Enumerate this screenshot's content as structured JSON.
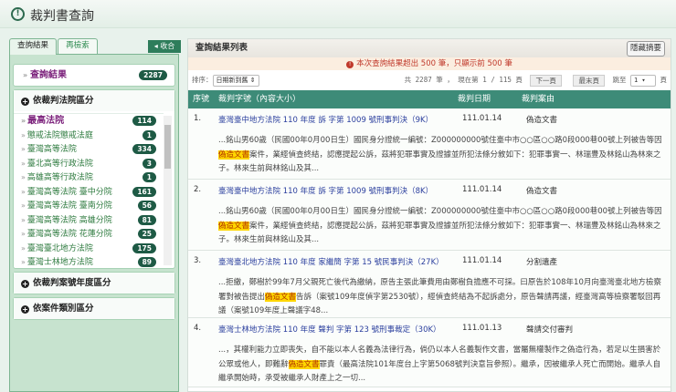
{
  "header": {
    "title": "裁判書查詢"
  },
  "sidebar": {
    "tabs": [
      "查詢結果",
      "再檢索"
    ],
    "collapse_label": "收合",
    "results": {
      "label": "查詢結果",
      "count": "2287"
    },
    "court_section": {
      "title": "依裁判法院區分",
      "items": [
        {
          "label": "最高法院",
          "count": "114"
        },
        {
          "label": "懲戒法院懲戒法庭",
          "count": "1"
        },
        {
          "label": "臺灣高等法院",
          "count": "334"
        },
        {
          "label": "臺北高等行政法院",
          "count": "3"
        },
        {
          "label": "高雄高等行政法院",
          "count": "1"
        },
        {
          "label": "臺灣高等法院 臺中分院",
          "count": "161"
        },
        {
          "label": "臺灣高等法院 臺南分院",
          "count": "56"
        },
        {
          "label": "臺灣高等法院 高雄分院",
          "count": "81"
        },
        {
          "label": "臺灣高等法院 花蓮分院",
          "count": "25"
        },
        {
          "label": "臺灣臺北地方法院",
          "count": "175"
        },
        {
          "label": "臺灣士林地方法院",
          "count": "89"
        }
      ]
    },
    "year_section": {
      "title": "依裁判案號年度區分"
    },
    "type_section": {
      "title": "依案件類別區分"
    }
  },
  "main": {
    "title": "查詢結果列表",
    "hide_summary": "隱藏摘要",
    "warning": "本次查詢結果超出 500 筆，只顯示前 500 筆",
    "sort_label": "排序：",
    "sort_value": "日期新到舊 ⇕",
    "paging": "共 2287 筆 ， 現在第 1 / 115 頁",
    "next": "下一頁",
    "last": "最末頁",
    "jump_label": "跳至",
    "jump_value": "1 ▾",
    "page_unit": "頁",
    "columns": [
      "序號",
      "裁判字號（內容大小）",
      "裁判日期",
      "裁判案由"
    ],
    "rows": [
      {
        "num": "1.",
        "title": "臺灣臺中地方法院 110 年度 訴 字第 1009 號刑事判決（9K）",
        "date": "111.01.14",
        "reason": "偽造文書",
        "pre": "...銘山男60歲（民國00年0月00日生）國民身分證統一編號：Z000000000號住臺中市○○區○○路0段000巷00號上列被告等因",
        "hl": "偽造文書",
        "post": "案件，業經偵查終結，認應提起公訴，茲將犯罪事實及證據並所犯法條分敘如下：犯罪事實一、林瑞豊及林銘山為林來之子。林來生前與林銘山及其..."
      },
      {
        "num": "2.",
        "title": "臺灣臺中地方法院 110 年度 訴 字第 1009 號刑事判決（8K）",
        "date": "111.01.14",
        "reason": "偽造文書",
        "pre": "...銘山男60歲（民國00年0月00日生）國民身分證統一編號：Z000000000號住臺中市○○區○○路0段000巷00號上列被告等因",
        "hl": "偽造文書",
        "post": "案件，業經偵查終結，認應提起公訴，茲將犯罪事實及證據並所犯法條分敘如下：犯罪事實一、林瑞豊及林銘山為林來之子。林來生前與林銘山及其..."
      },
      {
        "num": "3.",
        "title": "臺灣臺北地方法院 110 年度 家繼簡 字第 15 號民事判決（27K）",
        "date": "111.01.14",
        "reason": "分割遺產",
        "pre": "...拒繳，鄭樹於99年7月父親死亡後代為繳納，原告主張此筆費用由鄭樹負擔應不可採。曰原告於108年10月向臺灣臺北地方檢察署對被告提出",
        "hl": "偽造文書",
        "post": "告訴（案號109年度偵字第2530號），經偵查終結為不起訴處分，原告聲請再議，經臺灣高等檢察署駁回再議（案號109年度上聲議字48..."
      },
      {
        "num": "4.",
        "title": "臺灣士林地方法院 110 年度 聲判 字第 123 號刑事裁定（30K）",
        "date": "111.01.13",
        "reason": "聲請交付審判",
        "pre": "...，其權利能力立即喪失，自不能以本人名義為法律行為，倘仍以本人名義製作文書，當屬無權製作之偽造行為，若足以生損害於公眾或他人，即難辭",
        "hl": "偽造文書",
        "post": "罪責（最高法院101年度台上字第5068號判決意旨參照）。繼承，因被繼承人死亡而開始。繼承人自繼承開始時，承受被繼承人財產上之一切..."
      }
    ]
  }
}
